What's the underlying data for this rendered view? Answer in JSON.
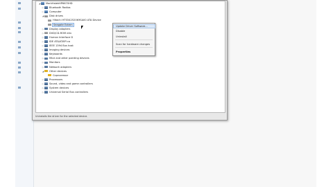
{
  "left_pane": {
    "items": [
      "",
      "",
      "",
      "",
      "",
      "",
      "",
      "",
      "",
      "",
      "",
      ""
    ]
  },
  "tree": [
    {
      "label": "MarkHalekHP6670HD",
      "level": 1,
      "expander": "◢",
      "icon": "comp"
    },
    {
      "label": "Bluetooth Radios",
      "level": 2,
      "expander": "▷",
      "icon": "dev"
    },
    {
      "label": "Computer",
      "level": 2,
      "expander": "▷",
      "icon": "comp"
    },
    {
      "label": "Disk drives",
      "level": 2,
      "expander": "◢",
      "icon": "disk"
    },
    {
      "label": "Hitachi HTS542520K9SA00 ATA Device",
      "level": 3,
      "expander": "",
      "icon": "disk"
    },
    {
      "label": "Seagate Extern",
      "level": 3,
      "expander": "",
      "icon": "disk",
      "selected": true
    },
    {
      "label": "Display adapters",
      "level": 2,
      "expander": "▷",
      "icon": "dev"
    },
    {
      "label": "DVD/CD-ROM driv",
      "level": 2,
      "expander": "▷",
      "icon": "disk"
    },
    {
      "label": "Human Interface D",
      "level": 2,
      "expander": "▷",
      "icon": "dev"
    },
    {
      "label": "IDE ATA/ATAPI co",
      "level": 2,
      "expander": "▷",
      "icon": "dev"
    },
    {
      "label": "IEEE 1394 Bus host",
      "level": 2,
      "expander": "▷",
      "icon": "dev"
    },
    {
      "label": "Imaging devices",
      "level": 2,
      "expander": "▷",
      "icon": "dev"
    },
    {
      "label": "Keyboards",
      "level": 2,
      "expander": "▷",
      "icon": "dev"
    },
    {
      "label": "Mice and other pointing devices",
      "level": 2,
      "expander": "▷",
      "icon": "dev"
    },
    {
      "label": "Monitors",
      "level": 2,
      "expander": "▷",
      "icon": "dev"
    },
    {
      "label": "Network adapters",
      "level": 2,
      "expander": "▷",
      "icon": "dev"
    },
    {
      "label": "Other devices",
      "level": 2,
      "expander": "◢",
      "icon": "warn"
    },
    {
      "label": "Coprocessor",
      "level": 3,
      "expander": "",
      "icon": "warn"
    },
    {
      "label": "Processors",
      "level": 2,
      "expander": "▷",
      "icon": "dev"
    },
    {
      "label": "Sound, video and game controllers",
      "level": 2,
      "expander": "▷",
      "icon": "dev"
    },
    {
      "label": "System devices",
      "level": 2,
      "expander": "▷",
      "icon": "dev"
    },
    {
      "label": "Universal Serial Bus controllers",
      "level": 2,
      "expander": "▷",
      "icon": "dev"
    }
  ],
  "context_menu": {
    "items": [
      "Update Driver Software...",
      "Disable",
      "Uninstall",
      "Scan for hardware changes",
      "Properties"
    ]
  },
  "status_bar": {
    "text": "Uninstalls the driver for the selected device."
  }
}
